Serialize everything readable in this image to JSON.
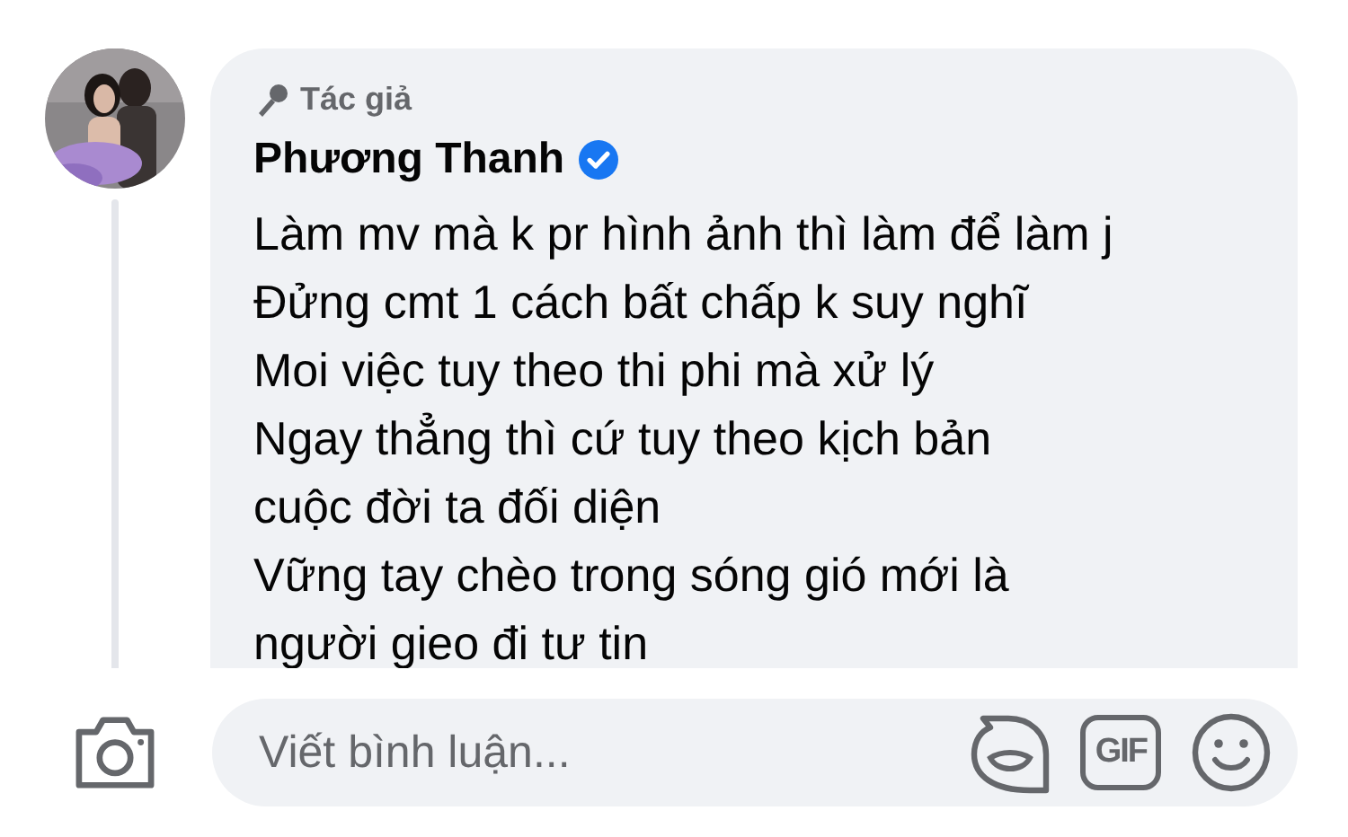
{
  "comment": {
    "author_badge": "Tác giả",
    "author": "Phương Thanh",
    "verified": true,
    "lines": [
      "Làm mv mà k pr hình ảnh thì làm để làm j",
      "Đửng cmt 1 cách bất chấp k suy nghĩ",
      "Moi việc tuy theo thi phi mà xử lý",
      "Ngay thẳng thì cứ tuy theo kịch bản",
      "cuộc đời ta đối diện",
      "Vững tay chèo trong sóng gió mới là",
      "người gieo đi tư tin"
    ]
  },
  "composer": {
    "placeholder": "Viết bình luận...",
    "gif_label": "GIF"
  }
}
